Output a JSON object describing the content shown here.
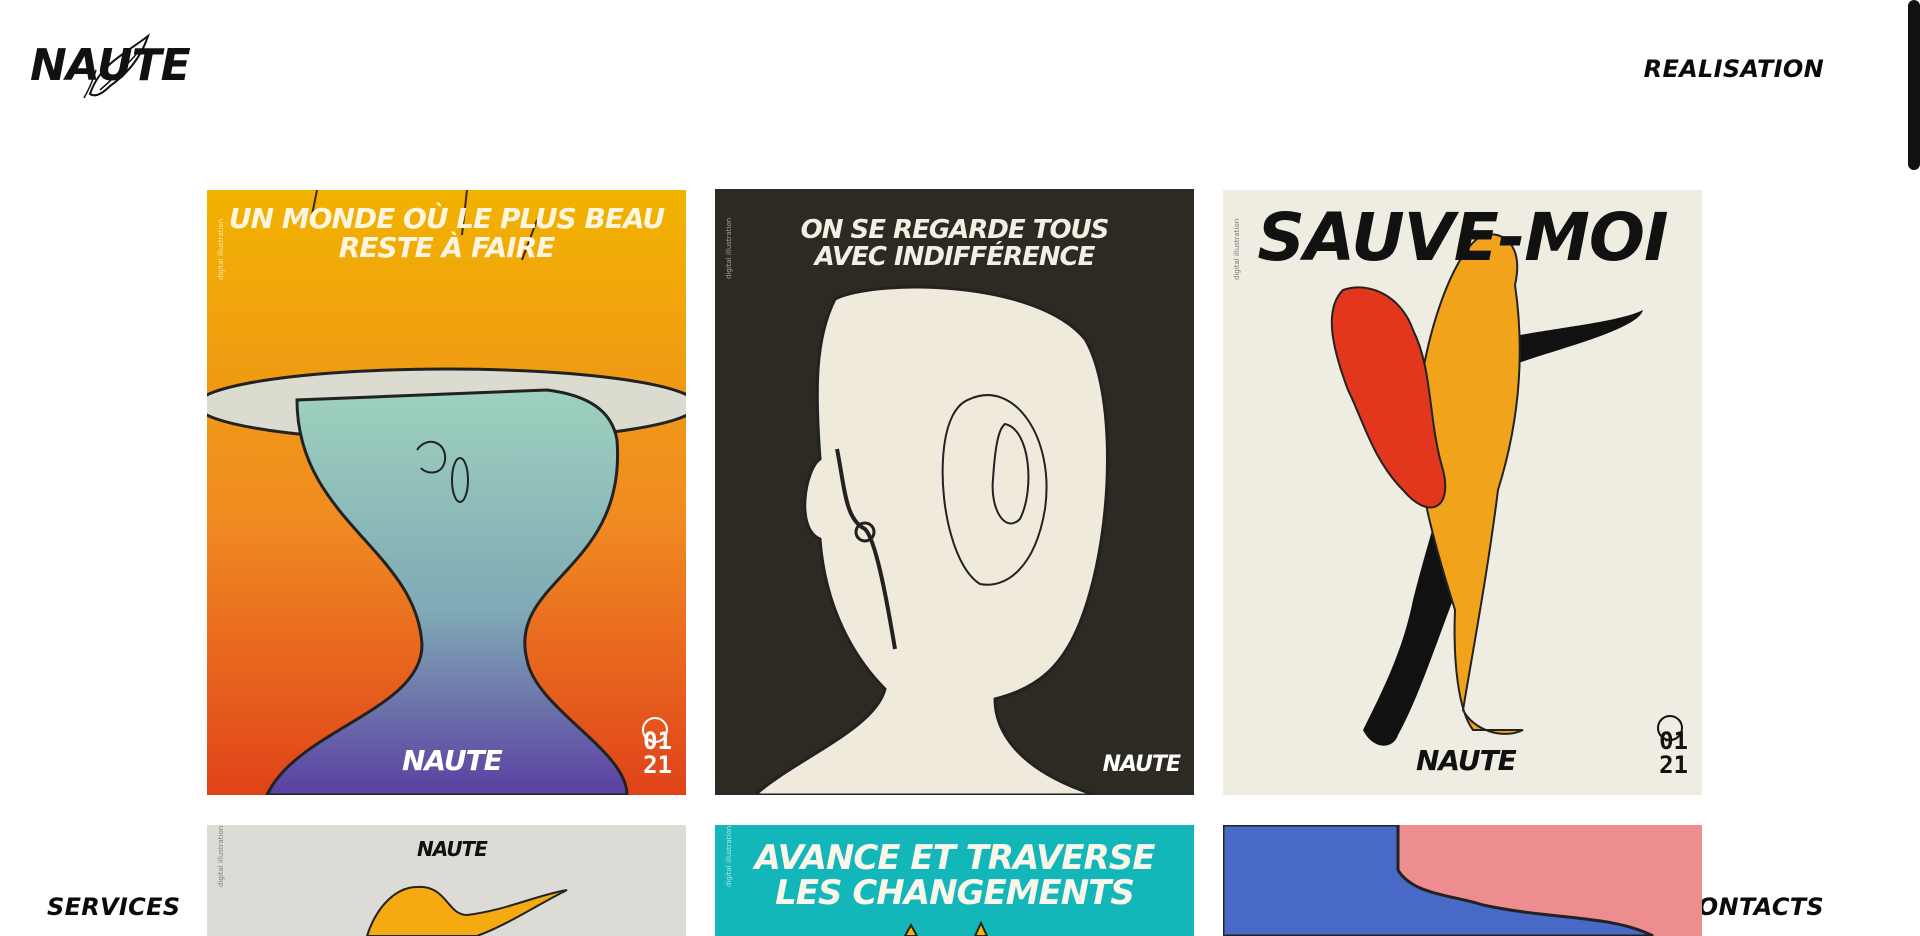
{
  "header": {
    "logo_text": "NAUTE",
    "nav_top": "REALISATION"
  },
  "footer": {
    "left": "SERVICES",
    "right": "CONTACTS"
  },
  "posters": [
    {
      "title_line1": "UN MONDE OÙ LE PLUS BEAU",
      "title_line2": "RESTE À FAIRE",
      "brand": "NAUTE",
      "date1": "01",
      "date2": "21",
      "side": "digital illustration"
    },
    {
      "title_line1": "ON SE REGARDE TOUS",
      "title_line2": "AVEC INDIFFÉRENCE",
      "brand": "NAUTE",
      "side": "digital illustration"
    },
    {
      "title_line1": "SAUVE-MOI",
      "brand": "NAUTE",
      "date1": "01",
      "date2": "21",
      "side": "digital illustration"
    },
    {
      "brand": "NAUTE",
      "side": "digital illustration"
    },
    {
      "title_line1": "AVANCE ET TRAVERSE",
      "title_line2": "LES CHANGEMENTS",
      "side": "digital illustration"
    },
    {}
  ],
  "colors": {
    "accent": "#111111",
    "bg": "#ffffff"
  }
}
